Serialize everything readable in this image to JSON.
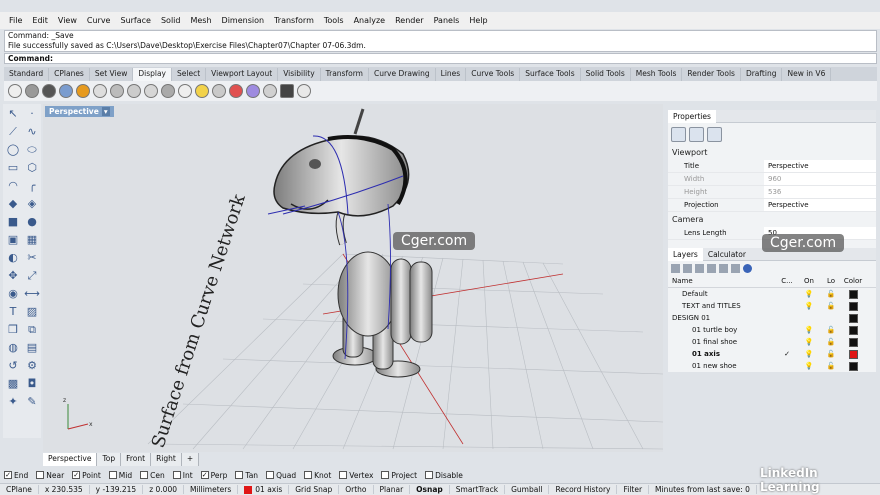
{
  "menu": [
    "File",
    "Edit",
    "View",
    "Curve",
    "Surface",
    "Solid",
    "Mesh",
    "Dimension",
    "Transform",
    "Tools",
    "Analyze",
    "Render",
    "Panels",
    "Help"
  ],
  "command_history": [
    "Command: _Save",
    "File successfully saved as C:\\Users\\Dave\\Desktop\\Exercise Files\\Chapter07\\Chapter 07-06.3dm."
  ],
  "command_prompt": "Command:",
  "toolbar_tabs": [
    "Standard",
    "CPlanes",
    "Set View",
    "Display",
    "Select",
    "Viewport Layout",
    "Visibility",
    "Transform",
    "Curve Drawing",
    "Lines",
    "Curve Tools",
    "Surface Tools",
    "Solid Tools",
    "Mesh Tools",
    "Render Tools",
    "Drafting",
    "New in V6"
  ],
  "active_toolbar_tab": "Display",
  "viewport": {
    "title": "Perspective",
    "model_text": "Surface from Curve Network",
    "tabs": [
      "Perspective",
      "Top",
      "Front",
      "Right"
    ]
  },
  "properties": {
    "tabs": [
      "Properties"
    ],
    "section_viewport": "Viewport",
    "rows": [
      {
        "k": "Title",
        "v": "Perspective"
      },
      {
        "k": "Width",
        "v": "960"
      },
      {
        "k": "Height",
        "v": "536"
      },
      {
        "k": "Projection",
        "v": "Perspective"
      }
    ],
    "section_camera": "Camera",
    "camera_rows": [
      {
        "k": "Lens Length",
        "v": "50"
      }
    ]
  },
  "layers": {
    "tabs": [
      "Layers",
      "Calculator"
    ],
    "headers": {
      "name": "Name",
      "current": "C...",
      "on": "On",
      "lock": "Lo",
      "color": "Color"
    },
    "rows": [
      {
        "name": "Default",
        "indent": 1,
        "current": "",
        "color": "#111111",
        "bold": false
      },
      {
        "name": "TEXT and TITLES",
        "indent": 1,
        "current": "",
        "color": "#111111",
        "bold": false
      },
      {
        "name": "DESIGN 01",
        "indent": 0,
        "current": "",
        "color": "#111111",
        "bold": false
      },
      {
        "name": "01 turtle boy",
        "indent": 2,
        "current": "",
        "color": "#111111",
        "bold": false
      },
      {
        "name": "01 final shoe",
        "indent": 2,
        "current": "",
        "color": "#111111",
        "bold": false
      },
      {
        "name": "01 axis",
        "indent": 2,
        "current": "✓",
        "color": "#e01616",
        "bold": true
      },
      {
        "name": "01 new shoe",
        "indent": 2,
        "current": "",
        "color": "#111111",
        "bold": false
      }
    ]
  },
  "osnaps": [
    {
      "label": "End",
      "on": true
    },
    {
      "label": "Near",
      "on": false
    },
    {
      "label": "Point",
      "on": true
    },
    {
      "label": "Mid",
      "on": false
    },
    {
      "label": "Cen",
      "on": false
    },
    {
      "label": "Int",
      "on": false
    },
    {
      "label": "Perp",
      "on": true
    },
    {
      "label": "Tan",
      "on": false
    },
    {
      "label": "Quad",
      "on": false
    },
    {
      "label": "Knot",
      "on": false
    },
    {
      "label": "Vertex",
      "on": false
    },
    {
      "label": "Project",
      "on": false
    },
    {
      "label": "Disable",
      "on": false
    }
  ],
  "status": {
    "cplane": "CPlane",
    "x": "x 230.535",
    "y": "y -139.215",
    "z": "z 0.000",
    "units": "Millimeters",
    "layer": "01 axis",
    "toggles": [
      "Grid Snap",
      "Ortho",
      "Planar",
      "Osnap",
      "SmartTrack",
      "Gumball",
      "Record History",
      "Filter"
    ],
    "last_save": "Minutes from last save: 0"
  },
  "watermarks": [
    "Cger.com",
    "Cger.com"
  ],
  "brand": "LinkedIn Learning"
}
